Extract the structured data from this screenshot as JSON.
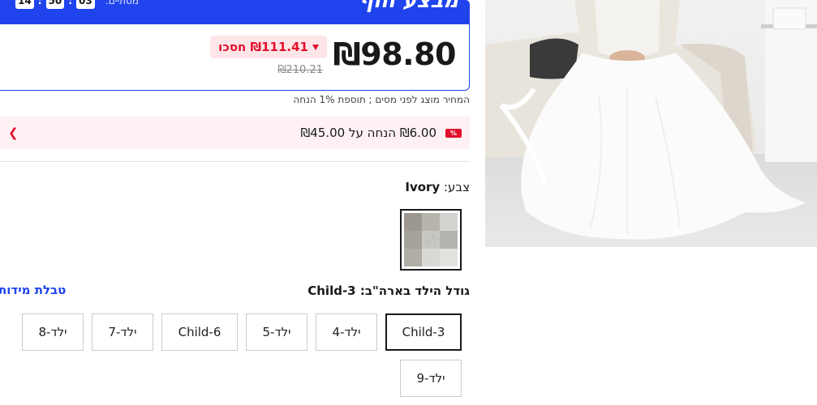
{
  "deal": {
    "title": "מבצע חוף",
    "ends_label": "מסתיים:",
    "countdown": [
      "14",
      "50",
      "03"
    ]
  },
  "price": {
    "current": "₪98.80",
    "savings": "₪111.41 חסכו",
    "original": "₪210.21",
    "tax_note": "המחיר מוצג לפני מסים ; תוספת 1% הנחה"
  },
  "coupon": {
    "text": "₪6.00 הנחה על ₪45.00",
    "icon_label": "%"
  },
  "color": {
    "label": "צבע:",
    "value": "Ivory"
  },
  "size": {
    "label": "גודל הילד בארה\"ב: Child-3",
    "chart_link": "טבלת מידות",
    "options": [
      "Child-3",
      "ילד-4",
      "ילד-5",
      "Child-6",
      "ילד-7",
      "ילד-8",
      "ילד-9"
    ],
    "selected": "Child-3"
  },
  "colors": {
    "accent": "#1f44ee",
    "sale_red": "#e0102c",
    "sale_bg": "#fde5e8"
  }
}
